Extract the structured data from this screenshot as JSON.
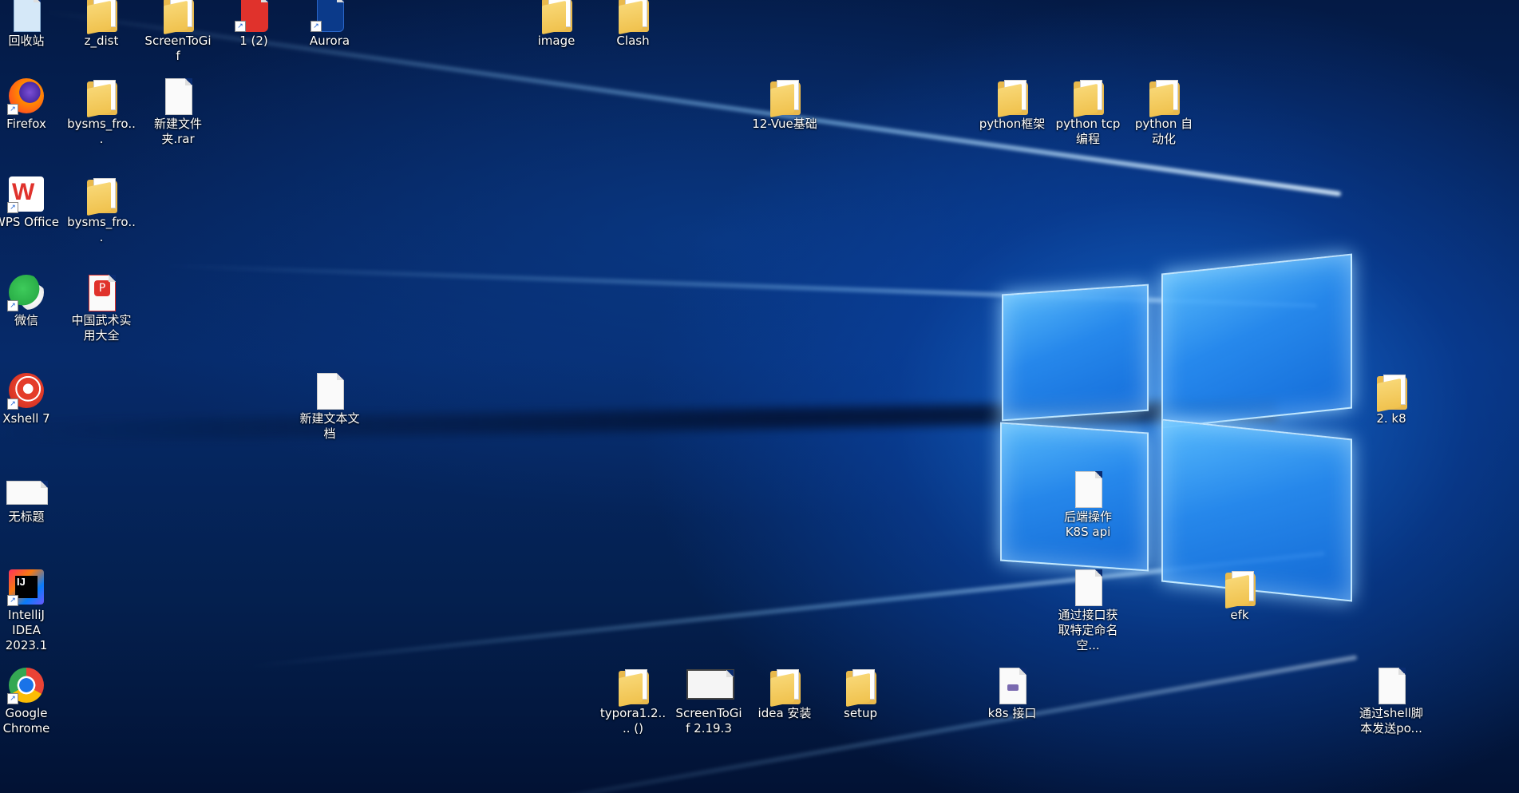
{
  "desktop": {
    "icons": [
      {
        "label": "回收站",
        "icon": "recycle-bin-icon"
      },
      {
        "label": "z_dist",
        "icon": "folder-icon"
      },
      {
        "label": "ScreenToGif",
        "icon": "folder-icon"
      },
      {
        "label": "1 (2)",
        "icon": "red-app-icon"
      },
      {
        "label": "Aurora",
        "icon": "aurora-app-icon"
      },
      {
        "label": "image",
        "icon": "folder-icon"
      },
      {
        "label": "Clash",
        "icon": "folder-icon"
      },
      {
        "label": "Firefox",
        "icon": "firefox-icon"
      },
      {
        "label": "bysms_fro...",
        "icon": "zip-folder-icon"
      },
      {
        "label": "新建文件夹.rar",
        "icon": "document-icon"
      },
      {
        "label": "12-Vue基础",
        "icon": "folder-icon"
      },
      {
        "label": "python框架",
        "icon": "folder-icon"
      },
      {
        "label": "python tcp 编程",
        "icon": "folder-icon"
      },
      {
        "label": "python 自动化",
        "icon": "folder-icon"
      },
      {
        "label": "WPS Office",
        "icon": "wps-office-icon"
      },
      {
        "label": "bysms_fro...",
        "icon": "zip-folder-icon"
      },
      {
        "label": "微信",
        "icon": "wechat-icon"
      },
      {
        "label": "中国武术实用大全",
        "icon": "pdf-document-icon"
      },
      {
        "label": "Xshell 7",
        "icon": "xshell-icon"
      },
      {
        "label": "新建文本文档",
        "icon": "document-icon"
      },
      {
        "label": "2. k8",
        "icon": "folder-icon"
      },
      {
        "label": "无标题",
        "icon": "image-thumbnail-icon"
      },
      {
        "label": "后端操作K8S api",
        "icon": "document-icon"
      },
      {
        "label": "IntelliJ IDEA 2023.1",
        "icon": "intellij-idea-icon"
      },
      {
        "label": "通过接口获取特定命名空...",
        "icon": "document-icon"
      },
      {
        "label": "efk",
        "icon": "folder-icon"
      },
      {
        "label": "Google Chrome",
        "icon": "chrome-icon"
      },
      {
        "label": "typora1.2.... ()",
        "icon": "folder-icon"
      },
      {
        "label": "ScreenToGif 2.19.3",
        "icon": "screentogif-app-icon"
      },
      {
        "label": "idea 安装",
        "icon": "folder-icon"
      },
      {
        "label": "setup",
        "icon": "folder-icon"
      },
      {
        "label": "k8s 接口",
        "icon": "markdown-document-icon"
      },
      {
        "label": "通过shell脚本发送po...",
        "icon": "document-icon"
      }
    ]
  },
  "colors": {
    "wallpaper_accent": "#1e8af0",
    "folder": "#f0c24e",
    "wps_red": "#e0322c",
    "xshell_red": "#e43d2a"
  }
}
